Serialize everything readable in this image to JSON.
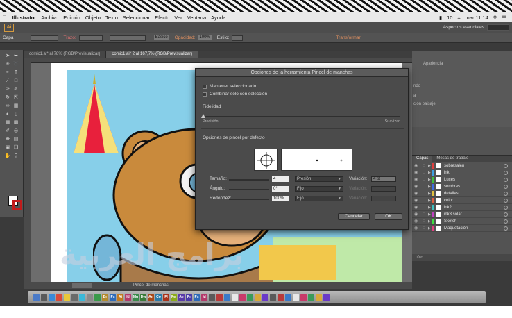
{
  "menubar": {
    "app_name": "Illustrator",
    "items": [
      "Archivo",
      "Edición",
      "Objeto",
      "Texto",
      "Seleccionar",
      "Efecto",
      "Ver",
      "Ventana",
      "Ayuda"
    ],
    "clock": "mar 11:14",
    "battery": "10"
  },
  "appbar": {
    "logo": "Ai",
    "workspace": "Aspectos esenciales"
  },
  "control_bar": {
    "selection_label": "Capa",
    "stroke_label": "Trazo:",
    "profile_value": "Básico",
    "opacity_label": "Opacidad:",
    "opacity_value": "100%",
    "style_label": "Estilo:",
    "transform_label": "Transformar"
  },
  "doc_tabs": [
    {
      "label": "comic1.ai* al 78% (RGB/Previsualizar)",
      "active": false
    },
    {
      "label": "comic1.ai* 2 al 167,7% (RGB/Previsualizar)",
      "active": true
    }
  ],
  "statusbar": {
    "tool_name": "Pincel de manchas"
  },
  "right_panel": {
    "rows": [
      "Apariencia",
      "ndo",
      "a",
      "ción paisaje"
    ]
  },
  "layers": {
    "tabs": [
      {
        "label": "Capas",
        "active": true
      },
      {
        "label": "Mesas de trabajo",
        "active": false
      }
    ],
    "items": [
      {
        "name": "sobresalen",
        "color": "#e04040"
      },
      {
        "name": "ink",
        "color": "#3fa0e0"
      },
      {
        "name": "Luces",
        "color": "#40c040"
      },
      {
        "name": "sombras",
        "color": "#3f6fe0"
      },
      {
        "name": "detalles",
        "color": "#e0c040"
      },
      {
        "name": "color",
        "color": "#e06040"
      },
      {
        "name": "ink2",
        "color": "#40c0c0"
      },
      {
        "name": "ink3 solar",
        "color": "#c040c0"
      },
      {
        "name": "Sketch",
        "color": "#40e040"
      },
      {
        "name": "Maquetación",
        "color": "#e04080"
      }
    ],
    "footer": "10 c..."
  },
  "dialog": {
    "title": "Opciones de la herramienta Pincel de manchas",
    "keep_selected": "Mantener seleccionado",
    "merge_selection": "Combinar sólo con selección",
    "fidelity_label": "Fidelidad",
    "fidelity_low": "Precisión",
    "fidelity_high": "Suavizar",
    "defaults_label": "Opciones de pincel por defecto",
    "size_label": "Tamaño:",
    "size_value": "4",
    "size_mode": "Presión",
    "size_variation_label": "Variación:",
    "size_variation_value": "4 pt",
    "angle_label": "Ángulo:",
    "angle_value": "0°",
    "angle_mode": "Fijo",
    "angle_variation_label": "Variación:",
    "roundness_label": "Redondez:",
    "roundness_value": "100%",
    "roundness_mode": "Fijo",
    "roundness_variation_label": "Variación:",
    "cancel": "Cancelar",
    "ok": "OK"
  },
  "dock": {
    "apps": [
      {
        "label": "Br",
        "color": "#b38b2c"
      },
      {
        "label": "Ps",
        "color": "#2d6ab8"
      },
      {
        "label": "Ai",
        "color": "#c27a1e"
      },
      {
        "label": "Id",
        "color": "#b33a6a"
      },
      {
        "label": "Mu",
        "color": "#3a8b4b"
      },
      {
        "label": "Dw",
        "color": "#3a7b3a"
      },
      {
        "label": "An",
        "color": "#a84a1a"
      },
      {
        "label": "Co",
        "color": "#2a7aa8"
      },
      {
        "label": "Fl",
        "color": "#a8321a"
      },
      {
        "label": "Fw",
        "color": "#8bab1a"
      },
      {
        "label": "Ae",
        "color": "#5a3aa8"
      },
      {
        "label": "Pr",
        "color": "#4a3aa8"
      },
      {
        "label": "Ps",
        "color": "#2d6ab8"
      },
      {
        "label": "Id",
        "color": "#b33a6a"
      }
    ]
  },
  "watermark": {
    "text": "برامج العربية"
  }
}
